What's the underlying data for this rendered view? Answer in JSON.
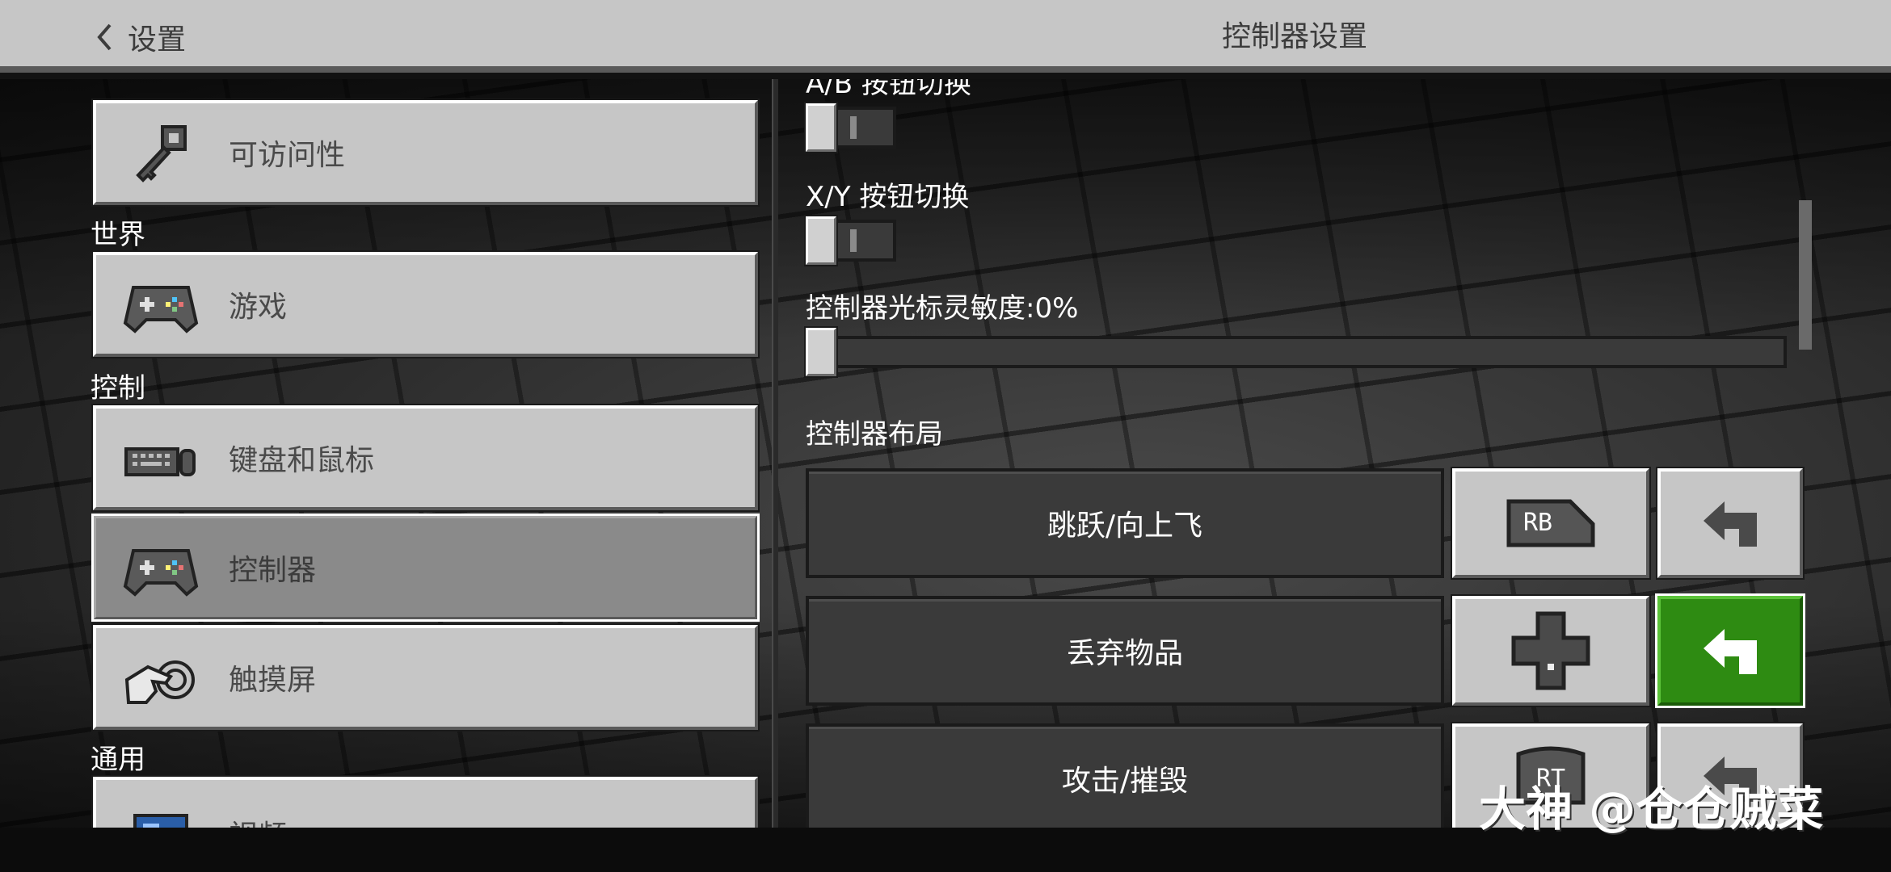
{
  "header": {
    "back_label": "设置",
    "title": "控制器设置"
  },
  "sidebar": {
    "sections": [
      {
        "label": "世界"
      },
      {
        "label": "控制"
      },
      {
        "label": "通用"
      }
    ],
    "items": [
      {
        "label": "可访问性",
        "icon": "key-icon"
      },
      {
        "label": "游戏",
        "icon": "gamepad-icon"
      },
      {
        "label": "键盘和鼠标",
        "icon": "keyboard-mouse-icon"
      },
      {
        "label": "控制器",
        "icon": "gamepad-icon",
        "selected": true
      },
      {
        "label": "触摸屏",
        "icon": "touch-hand-icon"
      },
      {
        "label": "视频",
        "icon": "video-icon"
      }
    ]
  },
  "settings": {
    "ab_toggle_label": "A/B 按钮切换",
    "ab_toggle_on": false,
    "xy_toggle_label": "X/Y 按钮切换",
    "xy_toggle_on": false,
    "sensitivity_label": "控制器光标灵敏度:0%",
    "sensitivity_value": 0,
    "layout_label": "控制器布局"
  },
  "bindings": [
    {
      "action": "跳跃/向上飞",
      "key": "RB",
      "key_icon": "rb-button-icon",
      "reset_active": false
    },
    {
      "action": "丢弃物品",
      "key": "",
      "key_icon": "dpad-down-icon",
      "reset_active": true
    },
    {
      "action": "攻击/摧毁",
      "key": "RT",
      "key_icon": "rt-button-icon",
      "reset_active": false
    }
  ],
  "watermark": "大神 @仓仓贼菜",
  "colors": {
    "panel_light": "#c6c6c6",
    "panel_dark": "#3a3a3a",
    "active_green": "#2e8b12",
    "selected_gray": "#8a8a8a"
  }
}
